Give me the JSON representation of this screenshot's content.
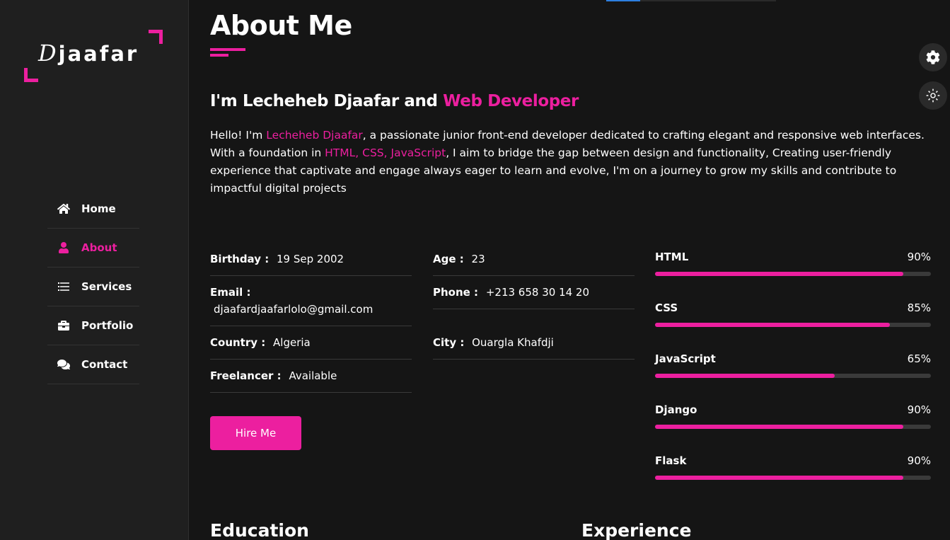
{
  "brand": {
    "logo_initial": "D",
    "logo_rest": "jaafar",
    "accent": "#ec1f9f",
    "background": "#151515",
    "sidebar_bg": "#1f1f1f"
  },
  "nav": {
    "items": [
      {
        "label": "Home",
        "icon": "home-icon",
        "active": false
      },
      {
        "label": "About",
        "icon": "user-icon",
        "active": true
      },
      {
        "label": "Services",
        "icon": "list-icon",
        "active": false
      },
      {
        "label": "Portfolio",
        "icon": "briefcase-icon",
        "active": false
      },
      {
        "label": "Contact",
        "icon": "comments-icon",
        "active": false
      }
    ]
  },
  "about": {
    "title": "About Me",
    "heading_prefix": "I'm Lecheheb Djaafar and ",
    "heading_role": "Web Developer",
    "p1_a": "Hello! I'm ",
    "p1_name": "Lecheheb Djaafar",
    "p1_b": ", a passionate junior front-end developer dedicated to crafting elegant and responsive web interfaces.",
    "p2_a": "With a foundation in ",
    "p2_tech": "HTML, CSS, JavaScript",
    "p2_b": ", I aim to bridge the gap between design and functionality, Creating user-friendly experience that captivate and engage always eager to learn and evolve, I'm on a journey to grow my skills and contribute to impactful digital projects"
  },
  "info": {
    "birthday": {
      "label": "Birthday :",
      "value": "19 Sep 2002"
    },
    "age": {
      "label": "Age :",
      "value": "23"
    },
    "email": {
      "label": "Email :",
      "value": "djaafardjaafarlolo@gmail.com"
    },
    "phone": {
      "label": "Phone :",
      "value": "+213 658 30 14 20"
    },
    "country": {
      "label": "Country :",
      "value": "Algeria"
    },
    "city": {
      "label": "City :",
      "value": "Ouargla Khafdji"
    },
    "freelancer": {
      "label": "Freelancer :",
      "value": "Available"
    }
  },
  "hire_button": "Hire Me",
  "skills": [
    {
      "name": "HTML",
      "percent_label": "90%",
      "level": 0.9
    },
    {
      "name": "CSS",
      "percent_label": "85%",
      "level": 0.85
    },
    {
      "name": "JavaScript",
      "percent_label": "65%",
      "level": 0.65
    },
    {
      "name": "Django",
      "percent_label": "90%",
      "level": 0.9
    },
    {
      "name": "Flask",
      "percent_label": "90%",
      "level": 0.9
    }
  ],
  "sections": {
    "education": "Education",
    "experience": "Experience"
  },
  "floating": [
    {
      "icon": "gear-icon"
    },
    {
      "icon": "sun-icon"
    }
  ]
}
